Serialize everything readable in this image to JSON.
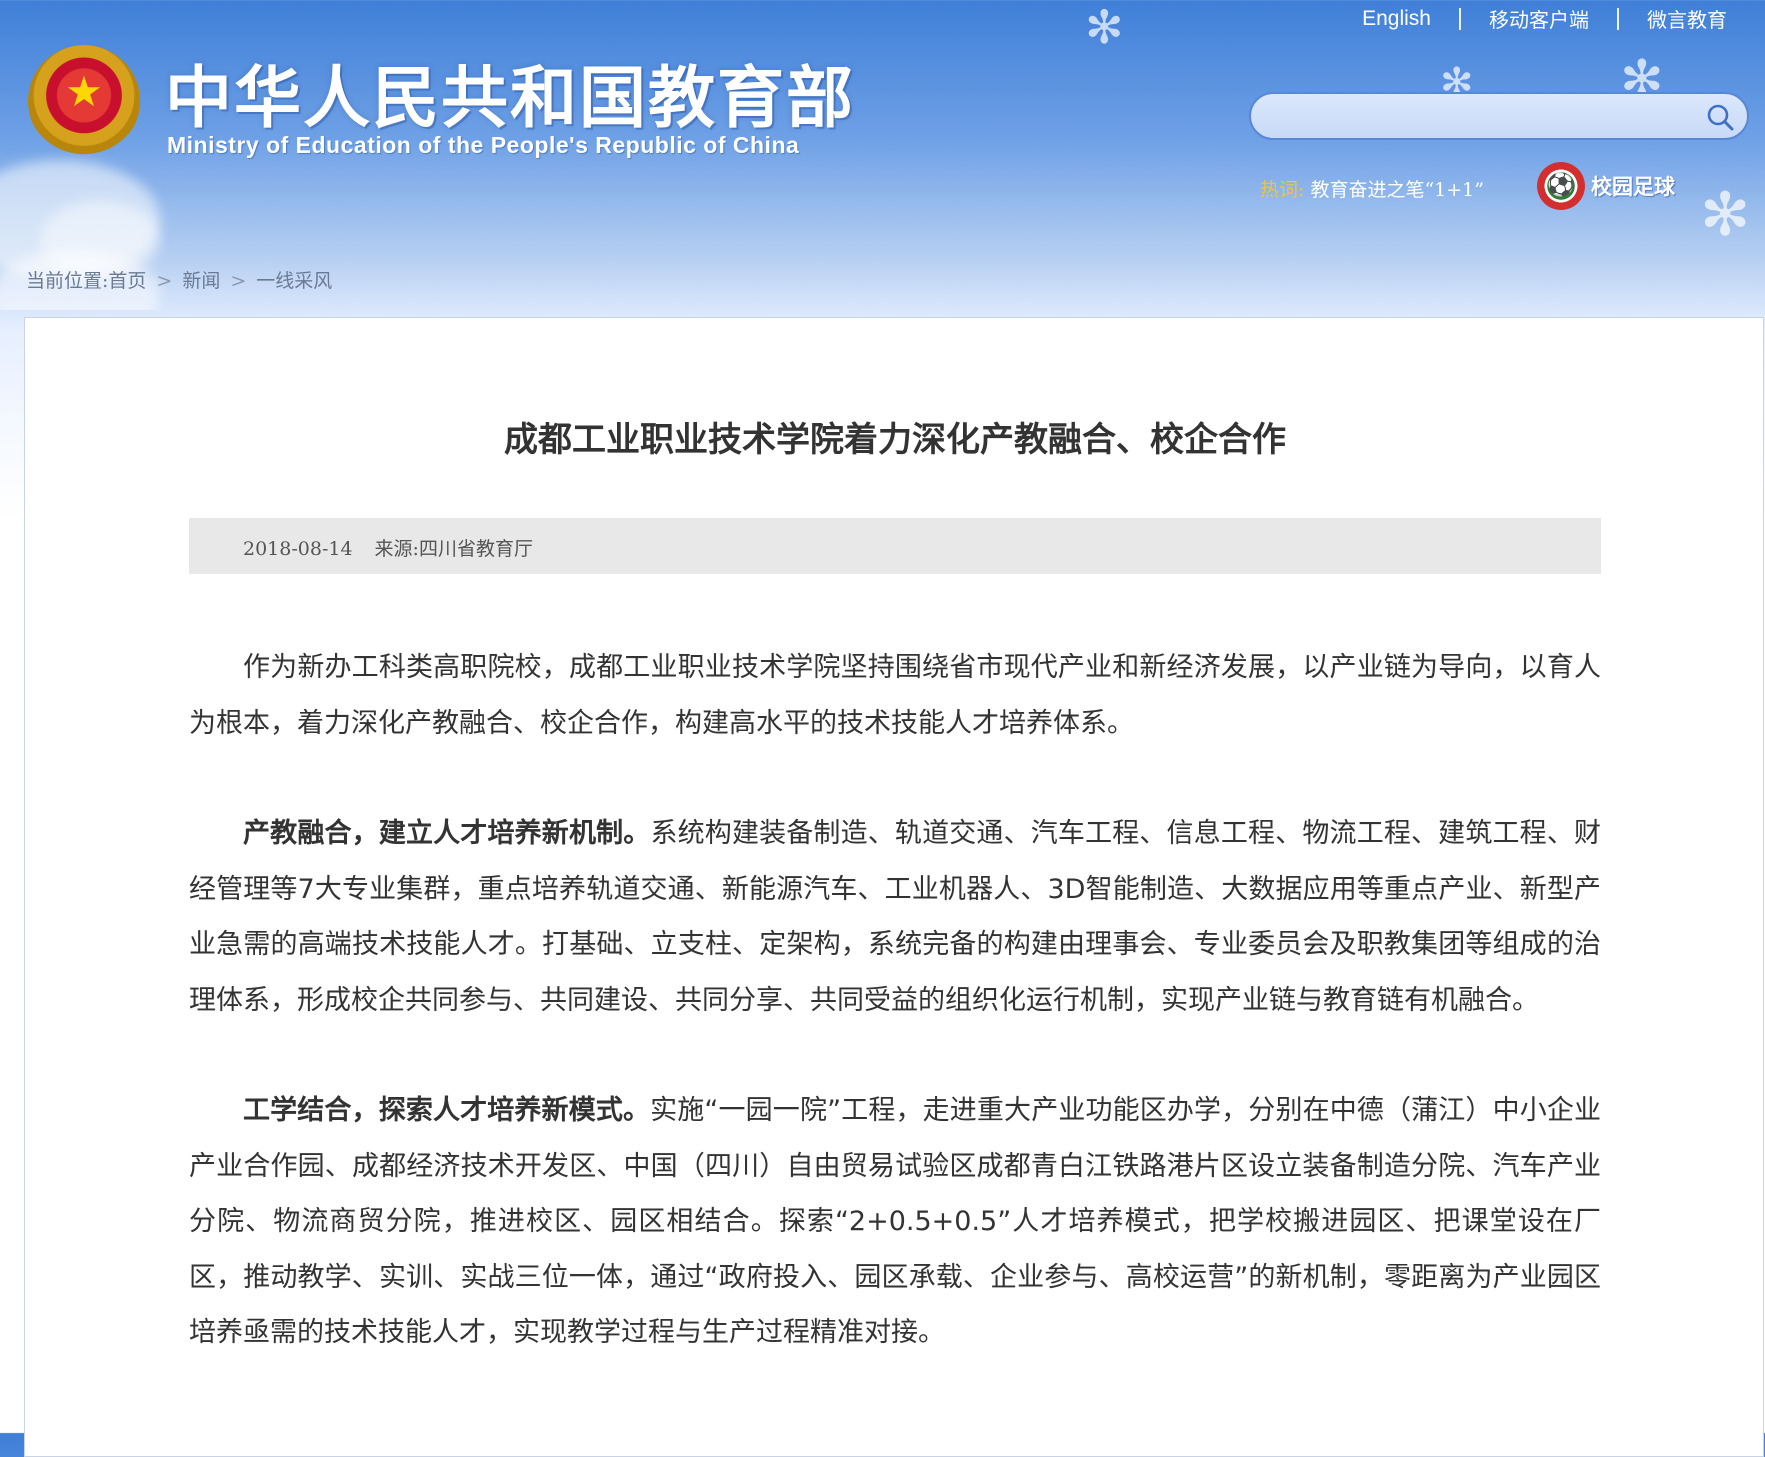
{
  "header": {
    "title_cn": "中华人民共和国教育部",
    "title_en": "Ministry of Education of the People's Republic of China",
    "top_links": [
      "English",
      "移动客户端",
      "微言教育"
    ],
    "search": {
      "value": "",
      "placeholder": ""
    },
    "hotwords": {
      "label": "热词:",
      "item": "教育奋进之笔“1+1”"
    },
    "campus_football": "校园足球"
  },
  "breadcrumb": {
    "prefix": "当前位置:",
    "items": [
      "首页",
      "新闻",
      "一线采风"
    ],
    "separator": ">"
  },
  "article": {
    "title": "成都工业职业技术学院着力深化产教融合、校企合作",
    "date": "2018-08-14",
    "source_label": "来源:",
    "source": "四川省教育厅",
    "paragraphs": [
      {
        "lead": "",
        "text": "作为新办工科类高职院校，成都工业职业技术学院坚持围绕省市现代产业和新经济发展，以产业链为导向，以育人为根本，着力深化产教融合、校企合作，构建高水平的技术技能人才培养体系。"
      },
      {
        "lead": "产教融合，建立人才培养新机制。",
        "text": "系统构建装备制造、轨道交通、汽车工程、信息工程、物流工程、建筑工程、财经管理等7大专业集群，重点培养轨道交通、新能源汽车、工业机器人、3D智能制造、大数据应用等重点产业、新型产业急需的高端技术技能人才。打基础、立支柱、定架构，系统完备的构建由理事会、专业委员会及职教集团等组成的治理体系，形成校企共同参与、共同建设、共同分享、共同受益的组织化运行机制，实现产业链与教育链有机融合。"
      },
      {
        "lead": "工学结合，探索人才培养新模式。",
        "text": "实施“一园一院”工程，走进重大产业功能区办学，分别在中德（蒲江）中小企业产业合作园、成都经济技术开发区、中国（四川）自由贸易试验区成都青白江铁路港片区设立装备制造分院、汽车产业分院、物流商贸分院，推进校区、园区相结合。探索“2+0.5+0.5”人才培养模式，把学校搬进园区、把课堂设在厂区，推动教学、实训、实战三位一体，通过“政府投入、园区承载、企业参与、高校运营”的新机制，零距离为产业园区培养亟需的技术技能人才，实现教学过程与生产过程精准对接。"
      }
    ]
  },
  "colors": {
    "banner_top": "#3f7fd8",
    "title_text": "#333333",
    "meta_bar": "#e8e8e8",
    "hotword_label": "#f3c33b"
  },
  "icons": {
    "emblem": "national-emblem-icon",
    "search": "search-icon",
    "football": "campus-football-icon"
  }
}
